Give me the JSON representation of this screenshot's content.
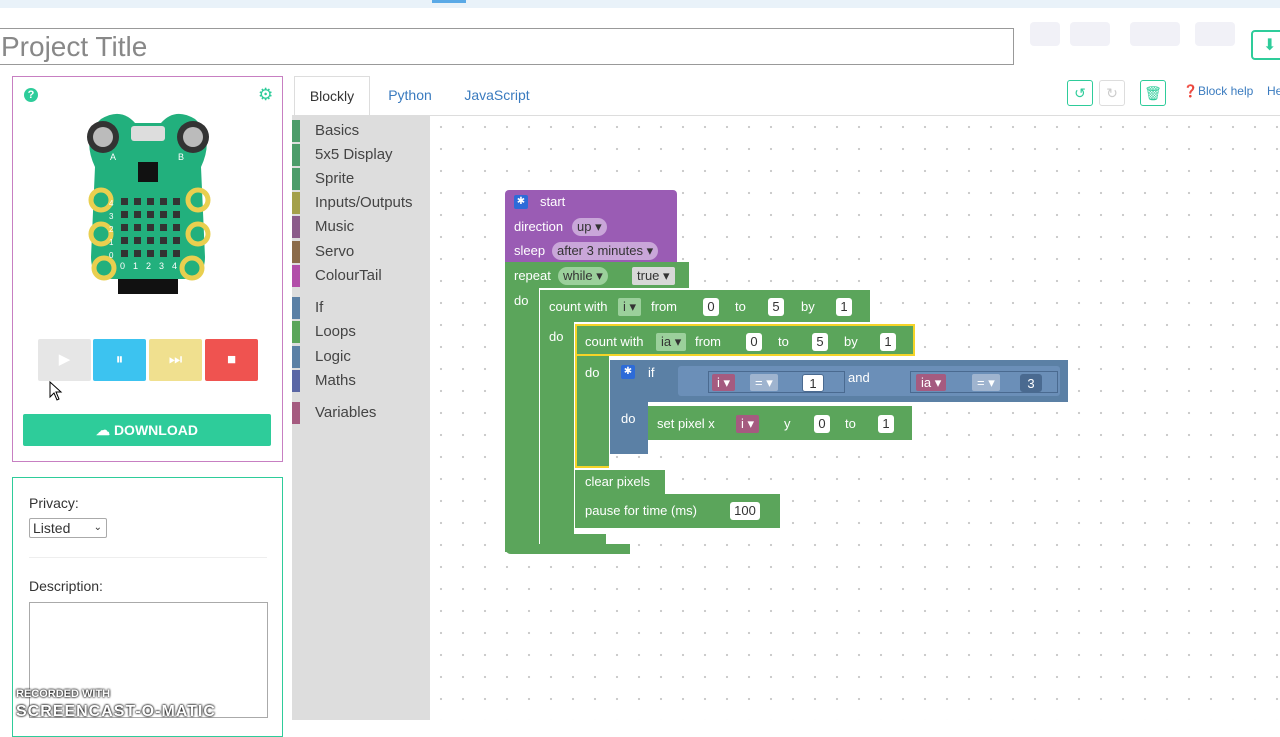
{
  "project": {
    "title_placeholder": "Project Title"
  },
  "simulator": {
    "button_a": "A",
    "button_b": "B",
    "row_labels": [
      "4",
      "3",
      "2",
      "1",
      "0"
    ],
    "col_labels": [
      "0",
      "1",
      "2",
      "3",
      "4"
    ],
    "controls": {
      "play": "▶",
      "pause": "⏸",
      "step": "⏭",
      "stop": "■"
    },
    "download_label": "DOWNLOAD"
  },
  "info": {
    "privacy_label": "Privacy:",
    "privacy_value": "Listed",
    "description_label": "Description:"
  },
  "tabs": [
    "Blockly",
    "Python",
    "JavaScript"
  ],
  "toolbar": {
    "undo": "↺",
    "redo": "↻",
    "delete": "🗑",
    "block_help": "Block help",
    "help_cut": "He"
  },
  "toolbox": [
    {
      "label": "Basics",
      "color": "#4c9c6a"
    },
    {
      "label": "5x5 Display",
      "color": "#4c9c6a"
    },
    {
      "label": "Sprite",
      "color": "#4c9c6a"
    },
    {
      "label": "Inputs/Outputs",
      "color": "#a4a04a"
    },
    {
      "label": "Music",
      "color": "#8b5b8a"
    },
    {
      "label": "Servo",
      "color": "#8b6b4a"
    },
    {
      "label": "ColourTail",
      "color": "#b24ea9"
    },
    {
      "label": "If",
      "color": "#5b80a5"
    },
    {
      "label": "Loops",
      "color": "#5ba55b"
    },
    {
      "label": "Logic",
      "color": "#5b80a5"
    },
    {
      "label": "Maths",
      "color": "#5b67a5"
    },
    {
      "label": "Variables",
      "color": "#a55b80"
    }
  ],
  "blocks": {
    "start": "start",
    "direction_label": "direction",
    "direction_value": "up",
    "sleep_label": "sleep",
    "sleep_value": "after 3 minutes",
    "repeat_label": "repeat",
    "repeat_mode": "while",
    "repeat_cond": "true",
    "do": "do",
    "count_with": "count with",
    "from": "from",
    "to": "to",
    "by": "by",
    "outer": {
      "var": "i",
      "from": "0",
      "to": "5",
      "by": "1"
    },
    "inner": {
      "var": "ia",
      "from": "0",
      "to": "5",
      "by": "1"
    },
    "if_label": "if",
    "and_label": "and",
    "eq": "=",
    "cmp1": {
      "var": "i",
      "value": "1"
    },
    "cmp2": {
      "var": "ia",
      "value": "3"
    },
    "set_pixel": "set pixel x",
    "set_x_var": "i",
    "y_label": "y",
    "y_value": "0",
    "set_to_value": "1",
    "clear_pixels": "clear pixels",
    "pause_label": "pause for time (ms)",
    "pause_value": "100"
  },
  "watermark": {
    "line1": "RECORDED WITH",
    "line2": "SCREENCAST-O-MATIC"
  }
}
